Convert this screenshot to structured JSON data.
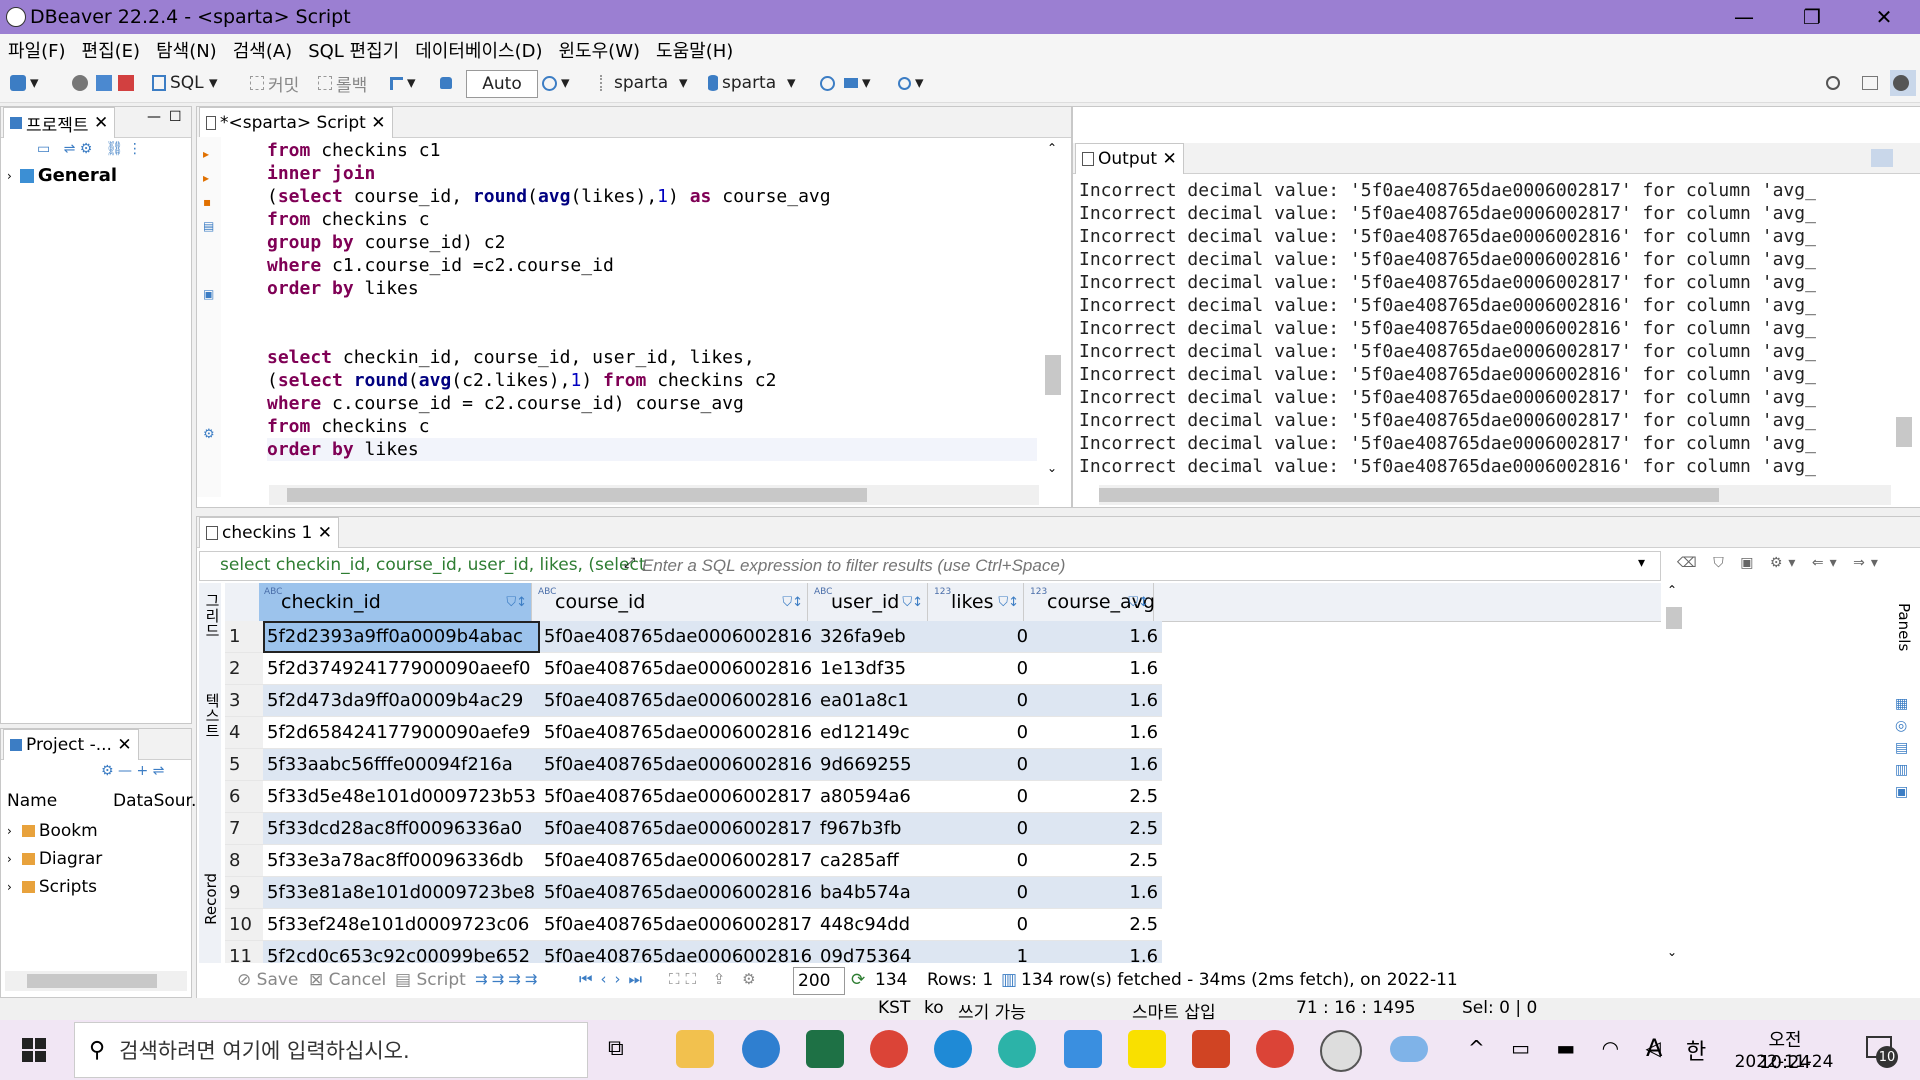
{
  "window": {
    "title": "DBeaver 22.2.4 - <sparta> Script"
  },
  "menu": [
    "파일(F)",
    "편집(E)",
    "탐색(N)",
    "검색(A)",
    "SQL 편집기",
    "데이터베이스(D)",
    "윈도우(W)",
    "도움말(H)"
  ],
  "toolbar": {
    "sql": "SQL",
    "commit": "커밋",
    "rollback": "롤백",
    "auto": "Auto",
    "datasource": "sparta",
    "schema": "sparta"
  },
  "project_panel": {
    "tab": "프로젝트",
    "root": "General"
  },
  "project2_panel": {
    "tab": "Project -...",
    "col_name": "Name",
    "col_ds": "DataSour.",
    "items": [
      "Bookm",
      "Diagrar",
      "Scripts"
    ]
  },
  "editor": {
    "tab": "*<sparta> Script",
    "lines": [
      "from checkins c1",
      "inner join",
      "(select course_id, round(avg(likes),1) as course_avg",
      "from checkins c",
      "group by course_id) c2",
      "where c1.course_id =c2.course_id",
      "order by likes",
      "",
      "",
      "select checkin_id, course_id, user_id, likes,",
      "(select round(avg(c2.likes),1) from checkins c2",
      "where c.course_id = c2.course_id) course_avg",
      "from checkins c",
      "order by likes"
    ]
  },
  "output": {
    "tab": "Output",
    "lines": [
      "Incorrect decimal value: '5f0ae408765dae0006002817' for column 'avg_",
      "Incorrect decimal value: '5f0ae408765dae0006002817' for column 'avg_",
      "Incorrect decimal value: '5f0ae408765dae0006002816' for column 'avg_",
      "Incorrect decimal value: '5f0ae408765dae0006002816' for column 'avg_",
      "Incorrect decimal value: '5f0ae408765dae0006002817' for column 'avg_",
      "Incorrect decimal value: '5f0ae408765dae0006002816' for column 'avg_",
      "Incorrect decimal value: '5f0ae408765dae0006002816' for column 'avg_",
      "Incorrect decimal value: '5f0ae408765dae0006002817' for column 'avg_",
      "Incorrect decimal value: '5f0ae408765dae0006002816' for column 'avg_",
      "Incorrect decimal value: '5f0ae408765dae0006002817' for column 'avg_",
      "Incorrect decimal value: '5f0ae408765dae0006002817' for column 'avg_",
      "Incorrect decimal value: '5f0ae408765dae0006002817' for column 'avg_",
      "Incorrect decimal value: '5f0ae408765dae0006002816' for column 'avg_"
    ]
  },
  "results": {
    "tab": "checkins 1",
    "query_preview": "select checkin_id, course_id, user_id, likes, (select",
    "filter_placeholder": "Enter a SQL expression to filter results (use Ctrl+Space)",
    "columns": [
      "checkin_id",
      "course_id",
      "user_id",
      "likes",
      "course_avg"
    ],
    "rows": [
      [
        "1",
        "5f2d2393a9ff0a0009b4abac",
        "5f0ae408765dae0006002816",
        "326fa9eb",
        "0",
        "1.6"
      ],
      [
        "2",
        "5f2d374924177900090aeef0",
        "5f0ae408765dae0006002816",
        "1e13df35",
        "0",
        "1.6"
      ],
      [
        "3",
        "5f2d473da9ff0a0009b4ac29",
        "5f0ae408765dae0006002816",
        "ea01a8c1",
        "0",
        "1.6"
      ],
      [
        "4",
        "5f2d658424177900090aefe9",
        "5f0ae408765dae0006002816",
        "ed12149c",
        "0",
        "1.6"
      ],
      [
        "5",
        "5f33aabc56fffe00094f216a",
        "5f0ae408765dae0006002816",
        "9d669255",
        "0",
        "1.6"
      ],
      [
        "6",
        "5f33d5e48e101d0009723b53",
        "5f0ae408765dae0006002817",
        "a80594a6",
        "0",
        "2.5"
      ],
      [
        "7",
        "5f33dcd28ac8ff00096336a0",
        "5f0ae408765dae0006002817",
        "f967b3fb",
        "0",
        "2.5"
      ],
      [
        "8",
        "5f33e3a78ac8ff00096336db",
        "5f0ae408765dae0006002817",
        "ca285aff",
        "0",
        "2.5"
      ],
      [
        "9",
        "5f33e81a8e101d0009723be8",
        "5f0ae408765dae0006002816",
        "ba4b574a",
        "0",
        "1.6"
      ],
      [
        "10",
        "5f33ef248e101d0009723c06",
        "5f0ae408765dae0006002817",
        "448c94dd",
        "0",
        "2.5"
      ],
      [
        "11",
        "5f2cd0c653c92c00099be652",
        "5f0ae408765dae0006002816",
        "09d75364",
        "1",
        "1.6"
      ]
    ],
    "side_labels": {
      "grid": "그리드",
      "text": "텍스트",
      "record": "Record",
      "panels": "Panels"
    },
    "bottom": {
      "save": "Save",
      "cancel": "Cancel",
      "script": "Script",
      "limit": "200",
      "count": "134",
      "rows": "Rows: 1",
      "status": "134 row(s) fetched - 34ms (2ms fetch), on 2022-11"
    }
  },
  "statusbar": {
    "tz": "KST",
    "lang": "ko",
    "writable": "쓰기 가능",
    "insert": "스마트 삽입",
    "pos": "71 : 16 : 1495",
    "sel": "Sel: 0 | 0"
  },
  "taskbar": {
    "search": "검색하려면 여기에 입력하십시오.",
    "time": "오전 10:24",
    "date": "2022-11-24",
    "ime": "A",
    "ime2": "한",
    "notif": "10"
  }
}
